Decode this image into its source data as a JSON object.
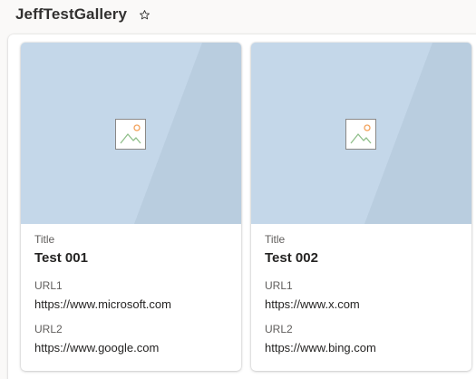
{
  "header": {
    "title": "JeffTestGallery",
    "favorite_icon": "star-outline-icon"
  },
  "cards": [
    {
      "image_icon": "image-placeholder-icon",
      "title_label": "Title",
      "title_value": "Test 001",
      "url1_label": "URL1",
      "url1_value": "https://www.microsoft.com",
      "url2_label": "URL2",
      "url2_value": "https://www.google.com"
    },
    {
      "image_icon": "image-placeholder-icon",
      "title_label": "Title",
      "title_value": "Test 002",
      "url1_label": "URL1",
      "url1_value": "https://www.x.com",
      "url2_label": "URL2",
      "url2_value": "https://www.bing.com"
    }
  ],
  "colors": {
    "thumbnail_background": "#c3d6e8",
    "thumbnail_shade": "#b7cbdc",
    "icon_sun": "#f2a25c",
    "icon_mountain": "#8fbf8a"
  }
}
